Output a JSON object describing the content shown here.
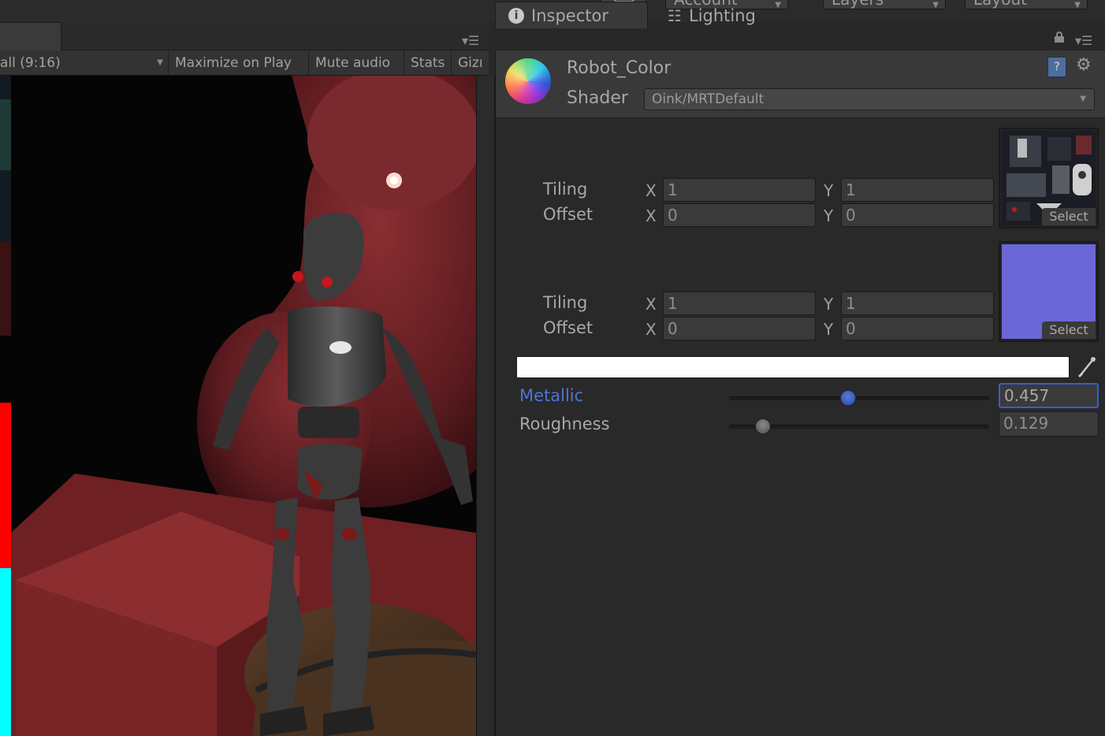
{
  "toolbar": {
    "account_label": "Account",
    "layers_label": "Layers",
    "layout_label": "Layout"
  },
  "game_view": {
    "aspect_label": "all (9:16)",
    "maximize_label": "Maximize on Play",
    "mute_label": "Mute audio",
    "stats_label": "Stats",
    "gizmos_label": "Gizı"
  },
  "inspector": {
    "tabs": [
      {
        "label": "Inspector",
        "icon": "info-icon"
      },
      {
        "label": "Lighting",
        "icon": "sliders-icon"
      }
    ],
    "material_name": "Robot_Color",
    "shader_label": "Shader",
    "shader_value": "Oink/MRTDefault",
    "textures": [
      {
        "tiling_label": "Tiling",
        "offset_label": "Offset",
        "tiling_x": "1",
        "tiling_y": "1",
        "offset_x": "0",
        "offset_y": "0",
        "select_label": "Select",
        "preview": "robot-albedo-texture"
      },
      {
        "tiling_label": "Tiling",
        "offset_label": "Offset",
        "tiling_x": "1",
        "tiling_y": "1",
        "offset_x": "0",
        "offset_y": "0",
        "select_label": "Select",
        "preview": "normal-map-texture",
        "color": "#6b66d6"
      }
    ],
    "axis_x": "X",
    "axis_y": "Y",
    "color_field": "#ffffff",
    "metallic": {
      "label": "Metallic",
      "value": "0.457",
      "fraction": 0.457
    },
    "roughness": {
      "label": "Roughness",
      "value": "0.129",
      "fraction": 0.129
    }
  }
}
